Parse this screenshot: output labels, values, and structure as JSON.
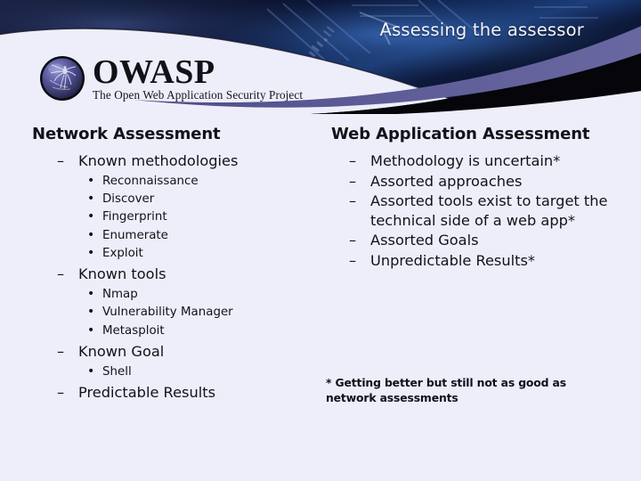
{
  "header": {
    "title": "Assessing the assessor",
    "logo": {
      "wordmark": "OWASP",
      "tagline": "The Open Web Application Security Project",
      "icon": "owasp-spider-globe-icon"
    },
    "colors": {
      "band_purple": "#5b5a94",
      "band_black": "#05050a",
      "photo_dark": "#0b1022",
      "photo_blue": "#2b4a86"
    }
  },
  "theme": {
    "background": "#eeeefb",
    "text": "#12121a"
  },
  "columns": {
    "left": {
      "heading": "Network Assessment",
      "items": [
        {
          "marker": "–",
          "label": "Known methodologies",
          "children": [
            {
              "marker": "•",
              "label": "Reconnaissance"
            },
            {
              "marker": "•",
              "label": "Discover"
            },
            {
              "marker": "•",
              "label": "Fingerprint"
            },
            {
              "marker": "•",
              "label": "Enumerate"
            },
            {
              "marker": "•",
              "label": "Exploit"
            }
          ]
        },
        {
          "marker": "–",
          "label": "Known tools",
          "children": [
            {
              "marker": "•",
              "label": "Nmap"
            },
            {
              "marker": "•",
              "label": "Vulnerability Manager"
            },
            {
              "marker": "•",
              "label": "Metasploit"
            }
          ]
        },
        {
          "marker": "–",
          "label": "Known Goal",
          "children": [
            {
              "marker": "•",
              "label": "Shell"
            }
          ]
        },
        {
          "marker": "–",
          "label": "Predictable Results",
          "children": []
        }
      ]
    },
    "right": {
      "heading": "Web Application Assessment",
      "items": [
        {
          "marker": "–",
          "label": "Methodology is uncertain*",
          "children": []
        },
        {
          "marker": "–",
          "label": "Assorted approaches",
          "children": []
        },
        {
          "marker": "–",
          "label": "Assorted tools exist to target the technical side of a web app*",
          "children": []
        },
        {
          "marker": "–",
          "label": "Assorted Goals",
          "children": []
        },
        {
          "marker": "–",
          "label": "Unpredictable Results*",
          "children": []
        }
      ],
      "footnote": "* Getting better but still not as good as network assessments"
    }
  }
}
